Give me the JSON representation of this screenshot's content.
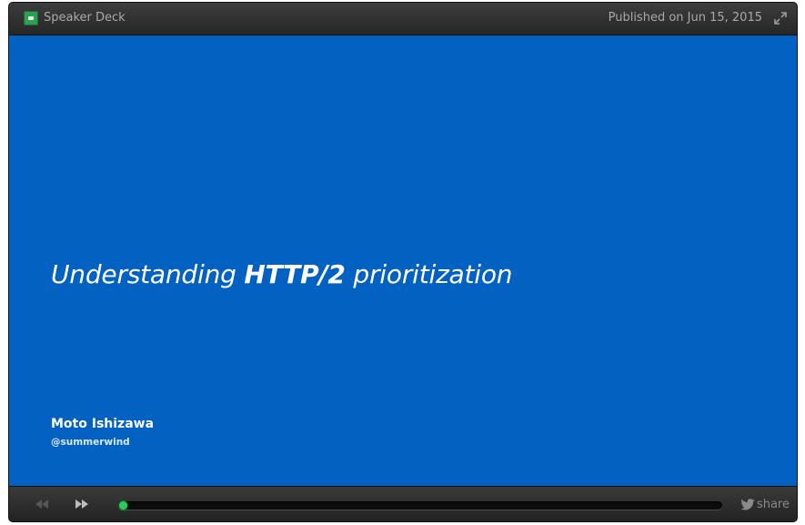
{
  "topbar": {
    "brand_label": "Speaker Deck",
    "published_label": "Published on Jun 15, 2015"
  },
  "slide": {
    "title_prefix": "Understanding ",
    "title_bold": "HTTP/2",
    "title_suffix": " prioritization",
    "author": "Moto Ishizawa",
    "handle": "@summerwind",
    "background_color": "#0261c1"
  },
  "controls": {
    "prev_icon": "rewind-icon",
    "next_icon": "fast-forward-icon",
    "share_label": "share",
    "share_icon": "twitter-bird-icon",
    "progress_fraction": 0.0
  },
  "colors": {
    "accent_green": "#22b24c",
    "chrome_dark": "#1f1f1f"
  }
}
